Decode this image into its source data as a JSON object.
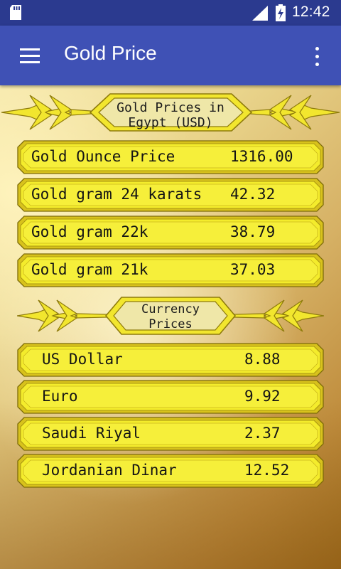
{
  "status_bar": {
    "time": "12:42",
    "icons": [
      "sd-card-icon",
      "signal-icon",
      "battery-charging-icon"
    ]
  },
  "app_bar": {
    "title": "Gold Price",
    "menu_icon": "hamburger-menu-icon",
    "overflow_icon": "more-vert-icon",
    "color": "#3f51b5"
  },
  "gold_section": {
    "heading_line1": "Gold Prices in",
    "heading_line2": "Egypt (USD)",
    "items": [
      {
        "label": "Gold Ounce Price",
        "value": "1316.00"
      },
      {
        "label": "Gold gram 24 karats",
        "value": "42.32"
      },
      {
        "label": "Gold gram 22k",
        "value": "38.79"
      },
      {
        "label": "Gold gram 21k",
        "value": "37.03"
      }
    ]
  },
  "currency_section": {
    "heading_line1": "Currency",
    "heading_line2": "Prices",
    "items": [
      {
        "label": "US Dollar",
        "value": "8.88"
      },
      {
        "label": "Euro",
        "value": "9.92"
      },
      {
        "label": "Saudi Riyal",
        "value": "2.37"
      },
      {
        "label": "Jordanian Dinar",
        "value": "12.52"
      }
    ]
  },
  "colors": {
    "plate_fill": "#f4ec2c",
    "plate_border": "#b8a313",
    "status_bar": "#2b3a8f"
  }
}
